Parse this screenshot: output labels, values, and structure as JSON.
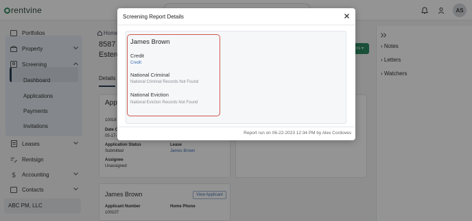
{
  "header": {
    "logo_text": "rentvine",
    "user_initials": "AS"
  },
  "sidebar": {
    "items": [
      {
        "label": "Portfolios"
      },
      {
        "label": "Property"
      },
      {
        "label": "Screening"
      },
      {
        "label": "Leases"
      },
      {
        "label": "Rentsign"
      },
      {
        "label": "Accounting"
      },
      {
        "label": "Contacts"
      }
    ],
    "screening_sub": [
      "Dashboard",
      "Applications",
      "Payments",
      "Invitations"
    ],
    "company": "ABC PM, LLC"
  },
  "background": {
    "breadcrumb": "Home",
    "title_line1": "8587 N",
    "title_line2": "Esterc",
    "tab": "Details",
    "card_title": "Appli",
    "application_status_label": "Application Status",
    "application_status_value": "Submitted",
    "lease_label": "Lease",
    "lease_value": "James Brown",
    "assignee_label": "Assignee",
    "assignee_value": "Unassigned",
    "applicant_name": "James Brown",
    "view_applicant": "View Applicant",
    "applicant_number_label": "Applicant Number",
    "applicant_number_value": "100107",
    "home_phone_label": "Home Phone",
    "date_label": "Date C",
    "date_value": "05-17-",
    "id_partial": "10018",
    "action_label": "ns"
  },
  "right_panel": {
    "items": [
      "Notes",
      "Letters",
      "Watchers"
    ]
  },
  "modal": {
    "title": "Screening Report Details",
    "applicant_name": "James Brown",
    "sections": [
      {
        "label": "Credit",
        "value": "Credit"
      },
      {
        "label": "National Criminal",
        "value": "National Criminal Records Not Found"
      },
      {
        "label": "National Eviction",
        "value": "National Eviction Records Not Found"
      }
    ],
    "footer": "Report run on 06-22-2023 12:34 PM by Alex Cordoves"
  },
  "colors": {
    "accent_green": "#2e8a62",
    "link_blue": "#3f6fb0",
    "highlight_red": "#d0564a"
  }
}
